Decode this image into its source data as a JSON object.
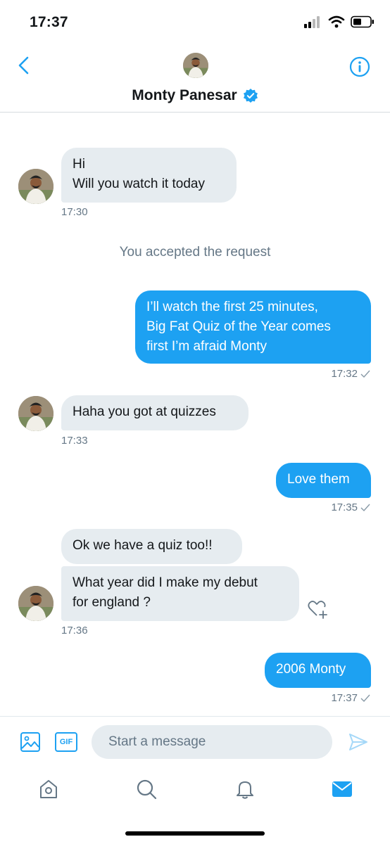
{
  "status_bar": {
    "time": "17:37"
  },
  "header": {
    "contact_name": "Monty Panesar"
  },
  "conversation": {
    "msg1": {
      "lines": "Hi\nWill you watch it today",
      "time": "17:30"
    },
    "system_note": "You accepted the request",
    "msg2": {
      "lines": "I’ll watch the first 25 minutes,\nBig Fat Quiz of the Year comes\nfirst I’m afraid Monty",
      "time": "17:32"
    },
    "msg3": {
      "lines": "Haha you got at quizzes",
      "time": "17:33"
    },
    "msg4": {
      "lines": "Love them",
      "time": "17:35"
    },
    "msg5": {
      "lines": "Ok we have a quiz too!!"
    },
    "msg6": {
      "lines": "What year did I make my debut\nfor england ?",
      "time": "17:36"
    },
    "msg7": {
      "lines": "2006 Monty",
      "time": "17:37"
    }
  },
  "compose": {
    "placeholder": "Start a message",
    "gif_label": "GIF"
  },
  "colors": {
    "accent": "#1da1f2",
    "incoming_bubble": "#e6ecf0",
    "muted_text": "#657786"
  },
  "icons": [
    "back-chevron-icon",
    "info-icon",
    "verified-badge-icon",
    "react-heart-icon",
    "image-icon",
    "gif-icon",
    "send-icon",
    "home-icon",
    "search-icon",
    "notifications-icon",
    "messages-icon"
  ]
}
